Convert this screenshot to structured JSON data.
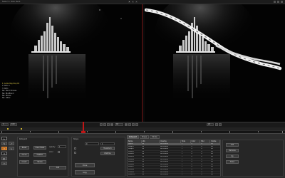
{
  "window": {
    "title": "Nuke 5 • Roto Paint"
  },
  "viewer_layers": {
    "items": [
      "1: Luma Key Dup 01",
      "2: Roto 1",
      "3: Roto",
      "Ne: Paint Strokes",
      "Ne: BlurBlend",
      "Ne: Stroke",
      "Ne: Other"
    ]
  },
  "timeline": {
    "frame_start": "1",
    "frame_end": "100",
    "current_frame": "44",
    "fps": "24"
  },
  "tools": {
    "items": [
      "select-icon",
      "brush-icon",
      "clone-icon",
      "blur-icon",
      "dodge-icon",
      "eraser-icon"
    ]
  },
  "panel_a": {
    "title": "Rotopaint",
    "btn_reset": "Reset",
    "btn_curve": "Curve",
    "btn_invert": "Invert",
    "btn_clear": "Clear Mask",
    "btn_feather": "Feather",
    "btn_stroke": "Stroke",
    "opacity_label": "opacity",
    "opacity_value": "1",
    "color_label": "color",
    "btn_add": "Add"
  },
  "panel_b": {
    "title": "Shape",
    "btn_transform": "Transform",
    "btn_lifetime": "Lifetime",
    "btn_clone": "Clone",
    "btn_copy": "Copy",
    "field_a": "0",
    "field_b": "1"
  },
  "tabs": [
    "Rotopaint",
    "Shape",
    "Stroke"
  ],
  "table": {
    "columns": [
      "Name",
      "Life",
      "Overlay",
      "Tools",
      "Color",
      "Blur",
      "Visible"
    ],
    "rows": [
      [
        "Layer1",
        "all",
        "All Frames",
        "1",
        "0",
        "0",
        "on"
      ],
      [
        "Shape1",
        "all",
        "All Frames",
        "1",
        "0",
        "0",
        "on"
      ],
      [
        "Shape2",
        "all",
        "All Frames",
        "1",
        "0",
        "0",
        "on"
      ],
      [
        "Stroke1",
        "all",
        "All Frames",
        "1",
        "0",
        "0",
        "on"
      ],
      [
        "Stroke2",
        "all",
        "All Frames",
        "1",
        "0",
        "0",
        "on"
      ],
      [
        "Stroke3",
        "all",
        "All Frames",
        "1",
        "0",
        "0",
        "on"
      ],
      [
        "Stroke4",
        "all",
        "All Frames",
        "1",
        "0",
        "0",
        "on"
      ],
      [
        "Stroke5",
        "all",
        "All Frames",
        "1",
        "0",
        "0",
        "on"
      ],
      [
        "Stroke6",
        "all",
        "All Frames",
        "1",
        "0",
        "0",
        "on"
      ],
      [
        "Stroke7",
        "all",
        "All Frames",
        "1",
        "0",
        "0",
        "on"
      ],
      [
        "Stroke8",
        "all",
        "All Frames",
        "1",
        "0",
        "0",
        "on"
      ],
      [
        "Stroke9",
        "all",
        "All Frames",
        "1",
        "0",
        "0",
        "on"
      ],
      [
        "Stroke10",
        "all",
        "All Frames",
        "1",
        "0",
        "0",
        "on"
      ]
    ]
  },
  "right_panel": {
    "btn_a": "Add",
    "btn_b": "Remove",
    "btn_c": "Up",
    "btn_d": "Down"
  }
}
